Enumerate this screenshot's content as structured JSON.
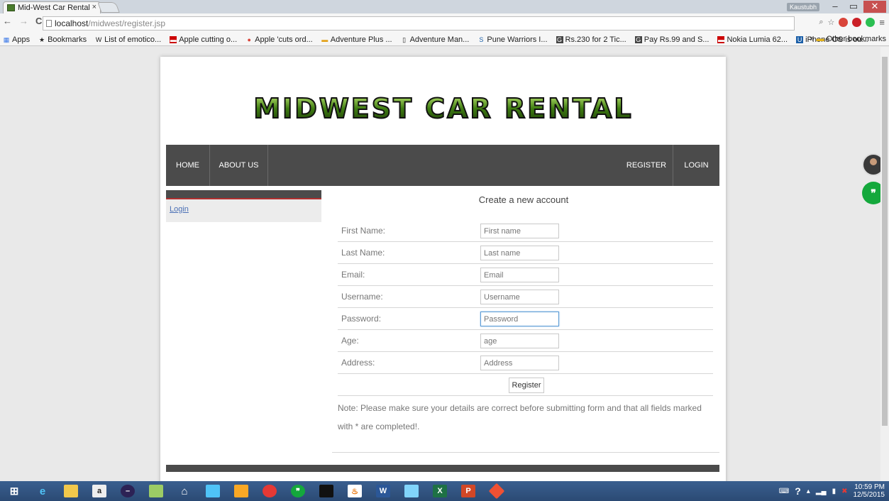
{
  "browser": {
    "tab_title": "Mid-West Car Rental",
    "tab_close": "×",
    "user_badge": "Kaustubh",
    "url_host": "localhost",
    "url_path": "/midwest/register.jsp",
    "bookmarks": [
      {
        "icon": "apps-icon",
        "label": "Apps"
      },
      {
        "icon": "star-icon",
        "label": "Bookmarks"
      },
      {
        "icon": "wikipedia-icon",
        "label": "List of emotico..."
      },
      {
        "icon": "news-icon",
        "label": "Apple cutting o..."
      },
      {
        "icon": "news-icon",
        "label": "Apple 'cuts ord..."
      },
      {
        "icon": "page-icon",
        "label": "Adventure Plus ..."
      },
      {
        "icon": "page-icon",
        "label": "Adventure Man..."
      },
      {
        "icon": "team-icon",
        "label": "Pune Warriors I..."
      },
      {
        "icon": "offer-icon",
        "label": "Rs.230 for 2 Tic..."
      },
      {
        "icon": "offer-icon",
        "label": "Pay Rs.99 and S..."
      },
      {
        "icon": "news-icon",
        "label": "Nokia Lumia 62..."
      },
      {
        "icon": "page-icon",
        "label": "iPhone OS is ou..."
      }
    ],
    "other_bookmarks": "Other bookmarks"
  },
  "site": {
    "logo_text": "MIDWEST CAR RENTAL",
    "nav": {
      "home": "HOME",
      "about": "ABOUT US",
      "register": "REGISTER",
      "login": "LOGIN"
    },
    "sidebar": {
      "login_link": "Login"
    },
    "form": {
      "title": "Create a new account",
      "fields": [
        {
          "label": "First Name:",
          "placeholder": "First name"
        },
        {
          "label": "Last Name:",
          "placeholder": "Last name"
        },
        {
          "label": "Email:",
          "placeholder": "Email"
        },
        {
          "label": "Username:",
          "placeholder": "Username"
        },
        {
          "label": "Password:",
          "placeholder": "Password"
        },
        {
          "label": "Age:",
          "placeholder": "age"
        },
        {
          "label": "Address:",
          "placeholder": "Address"
        }
      ],
      "submit_label": "Register",
      "note": "Note: Please make sure your details are correct before submitting form and that all fields marked with * are completed!."
    }
  },
  "taskbar": {
    "time": "10:59 PM",
    "date": "12/5/2015"
  }
}
